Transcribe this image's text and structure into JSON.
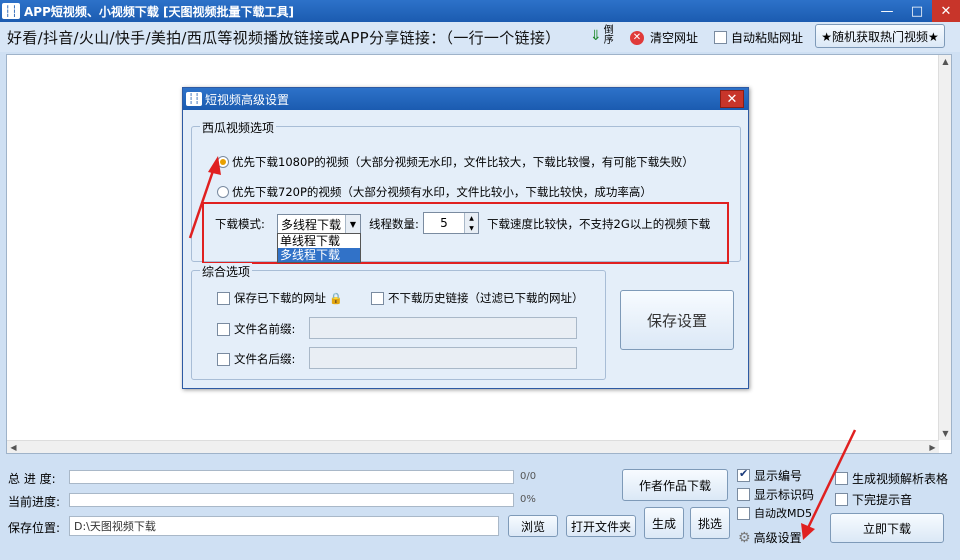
{
  "window": {
    "logo_text": "┆┆",
    "title": "APP短视频、小视频下载 [天图视频批量下载工具]",
    "min_glyph": "—",
    "max_glyph": "□",
    "close_glyph": "✕"
  },
  "toolbar": {
    "hint": "好看/抖音/火山/快手/美拍/西瓜等视频播放链接或APP分享链接：（一行一个链接）",
    "sort_label": "倒序",
    "clear_label": "清空网址",
    "auto_paste_label": "自动粘贴网址",
    "hot_videos_label": "★随机获取热门视频★"
  },
  "dialog": {
    "title": "短视频高级设置",
    "close_glyph": "✕",
    "xigua_group": {
      "legend": "西瓜视频选项",
      "option_1080": "优先下载1080P的视频（大部分视频无水印，文件比较大，下载比较慢，有可能下载失败）",
      "option_720": "优先下载720P的视频（大部分视频有水印，文件比较小，下载比较快，成功率高）",
      "selected": "1080"
    },
    "download_mode": {
      "label": "下载模式:",
      "value": "多线程下载",
      "options": [
        "单线程下载",
        "多线程下载"
      ]
    },
    "threads": {
      "label": "线程数量:",
      "value": "5",
      "hint": "下载速度比较快，不支持2G以上的视频下载"
    },
    "general_group": {
      "legend": "综合选项",
      "save_urls": "保存已下载的网址",
      "skip_history": "不下载历史链接（过滤已下载的网址）",
      "prefix_label": "文件名前缀:",
      "suffix_label": "文件名后缀:"
    },
    "save_button": "保存设置"
  },
  "bottom": {
    "total_progress_label": "总 进 度:",
    "total_progress_text": "0/0",
    "total_progress_value": 0,
    "current_progress_label": "当前进度:",
    "current_progress_text": "0%",
    "current_progress_value": 0,
    "save_path_label": "保存位置:",
    "save_path": "D:\\天图视频下载",
    "browse": "浏览",
    "open_folder": "打开文件夹",
    "author_works": "作者作品下载",
    "generate": "生成",
    "pick": "挑选",
    "show_number": "显示编号",
    "show_id": "显示标识码",
    "auto_md5": "自动改MD5",
    "gen_table": "生成视频解析表格",
    "done_sound": "下完提示音",
    "advanced": "高级设置",
    "download_now": "立即下载"
  }
}
